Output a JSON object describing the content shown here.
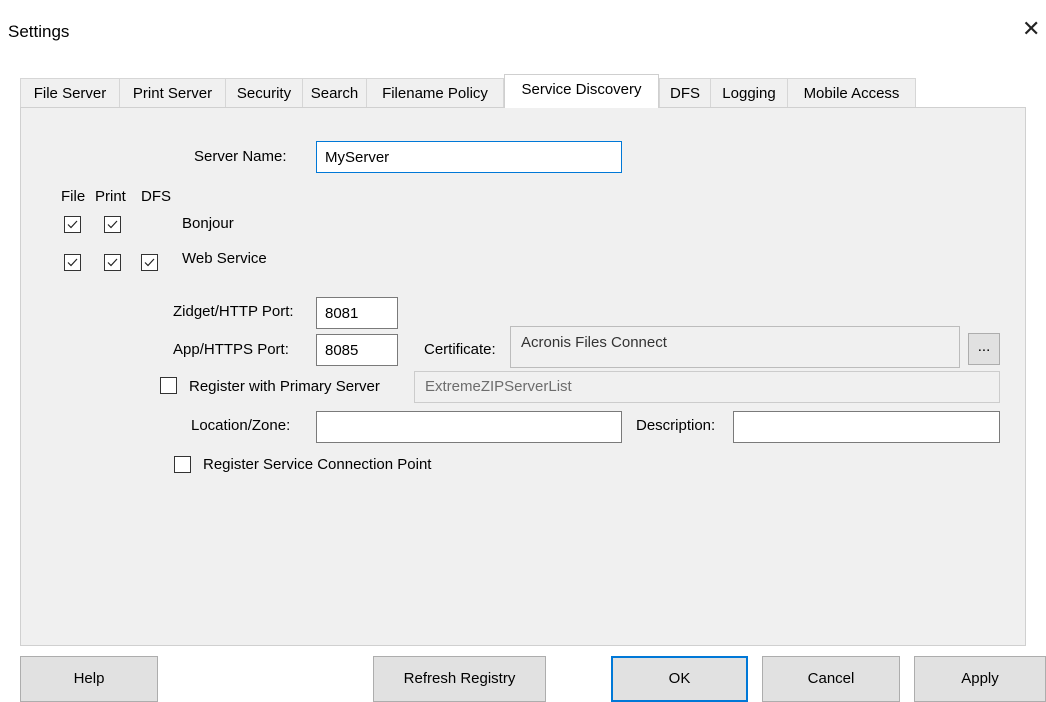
{
  "window": {
    "title": "Settings",
    "close_glyph": "✕"
  },
  "tabs": [
    {
      "label": "File Server"
    },
    {
      "label": "Print Server"
    },
    {
      "label": "Security"
    },
    {
      "label": "Search"
    },
    {
      "label": "Filename Policy"
    },
    {
      "label": "Service Discovery",
      "active": true
    },
    {
      "label": "DFS"
    },
    {
      "label": "Logging"
    },
    {
      "label": "Mobile Access"
    }
  ],
  "form": {
    "server_name_label": "Server Name:",
    "server_name_value": "MyServer",
    "col_headers": [
      "File",
      "Print",
      "DFS"
    ],
    "bonjour_label": "Bonjour",
    "bonjour_checks": {
      "file": true,
      "print": true
    },
    "web_service_label": "Web Service",
    "web_service_checks": {
      "file": true,
      "print": true,
      "dfs": true
    },
    "zidget_port_label": "Zidget/HTTP Port:",
    "zidget_port_value": "8081",
    "app_port_label": "App/HTTPS Port:",
    "app_port_value": "8085",
    "certificate_label": "Certificate:",
    "certificate_value": "Acronis Files Connect",
    "browse_label": "...",
    "register_primary_label": "Register with Primary Server",
    "register_primary_checked": false,
    "primary_server_value": "ExtremeZIPServerList",
    "location_label": "Location/Zone:",
    "location_value": "",
    "description_label": "Description:",
    "description_value": "",
    "scp_label": "Register Service Connection Point",
    "scp_checked": false
  },
  "buttons": {
    "help": "Help",
    "refresh": "Refresh Registry",
    "ok": "OK",
    "cancel": "Cancel",
    "apply": "Apply"
  },
  "colors": {
    "focus_accent": "#0078d7",
    "panel_bg": "#f0f0f0"
  }
}
